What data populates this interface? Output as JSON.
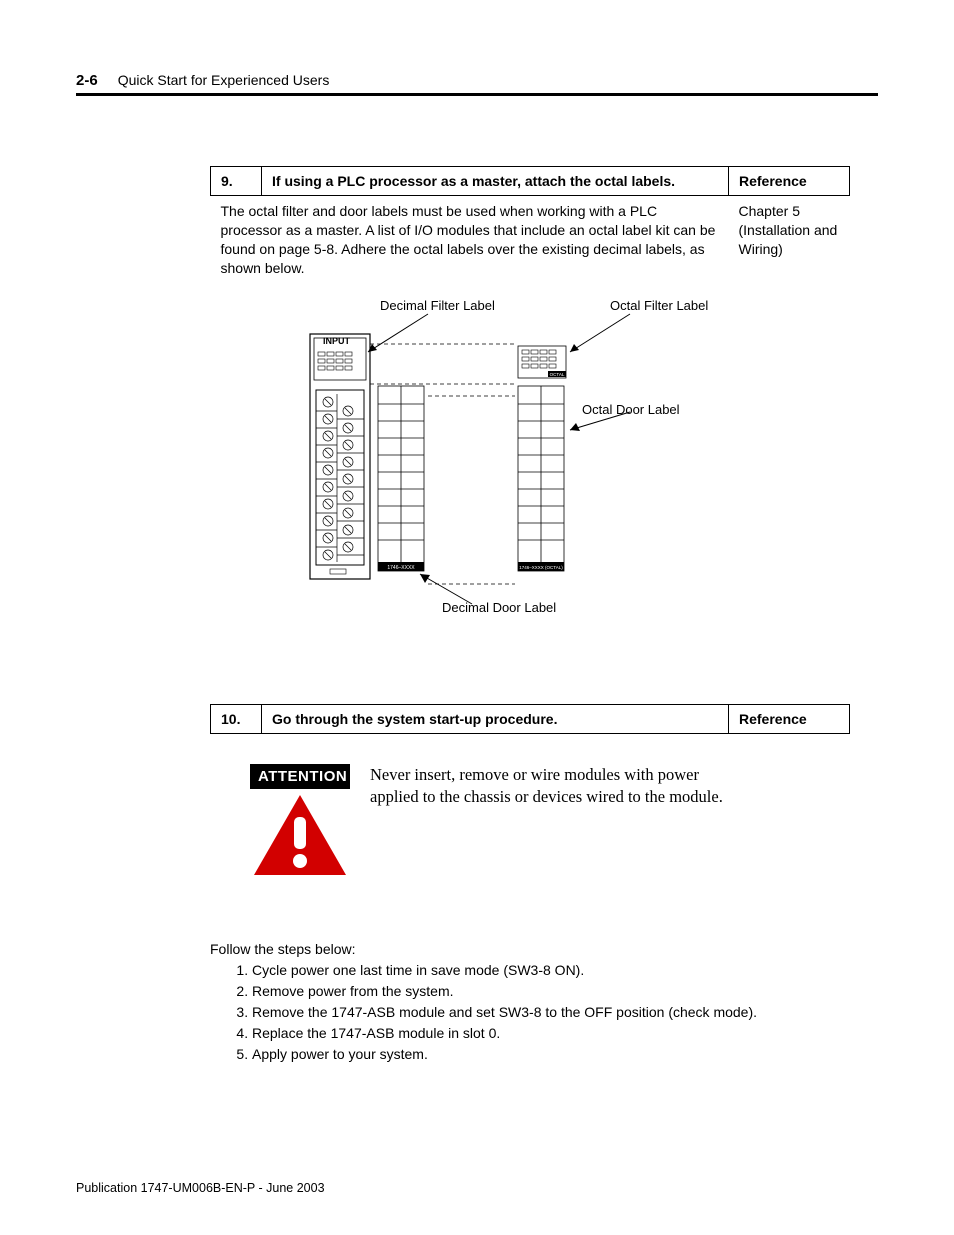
{
  "pageNumber": "2-6",
  "headerTitle": "Quick Start for Experienced Users",
  "step9": {
    "num": "9.",
    "title": "If using a PLC processor as a master, attach the octal labels.",
    "refHeader": "Reference",
    "desc": "The octal filter and door labels must be used when working with a PLC processor as a master. A list of I/O modules that include an octal label kit can be found on page 5-8. Adhere the octal labels over the existing decimal labels, as shown below.",
    "ref": "Chapter 5 (Installation and Wiring)"
  },
  "diagram": {
    "decimalFilterLabel": "Decimal Filter Label",
    "octalFilterLabel": "Octal Filter Label",
    "octalDoorLabel": "Octal Door Label",
    "decimalDoorLabel": "Decimal Door Label",
    "inputTag": "INPUT",
    "partLeft": "1746–XXXX",
    "partRight": "1746–XXXX  (OCTAL)",
    "octalSmall": "OCTAL"
  },
  "step10": {
    "num": "10.",
    "title": "Go through the system start-up procedure.",
    "refHeader": "Reference"
  },
  "attention": {
    "badge": "ATTENTION",
    "text": "Never insert, remove or wire modules with power applied to the chassis or devices wired to the module."
  },
  "follow": "Follow the steps below:",
  "steps": [
    "Cycle power one last time in save mode (SW3-8 ON).",
    "Remove power from the system.",
    "Remove the 1747-ASB module and set SW3-8 to the OFF position (check mode).",
    "Replace the 1747-ASB module in slot 0.",
    "Apply power to your system."
  ],
  "footer": "Publication 1747-UM006B-EN-P - June 2003"
}
